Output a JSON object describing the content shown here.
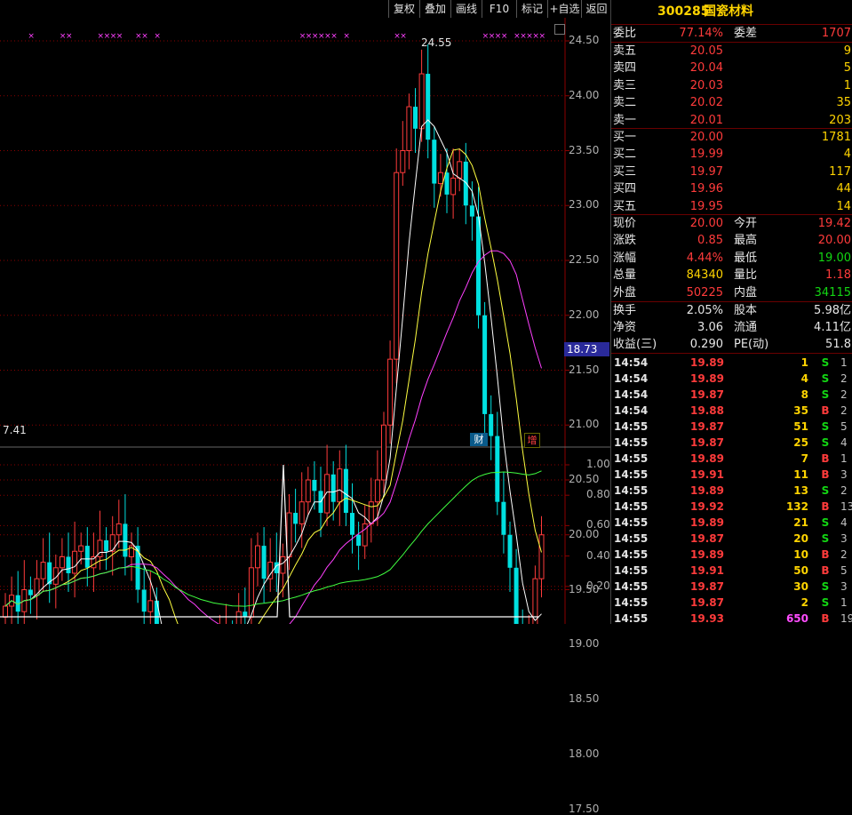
{
  "toolbar": {
    "buttons": [
      "复权",
      "叠加",
      "画线",
      "F10",
      "标记",
      "+自选",
      "返回"
    ]
  },
  "stock": {
    "code": "300285",
    "name": "国瓷材料"
  },
  "price_axis": {
    "labels": [
      "24.50",
      "24.00",
      "23.50",
      "23.00",
      "22.50",
      "22.00",
      "21.50",
      "21.00",
      "20.50",
      "20.00",
      "19.50",
      "19.00",
      "18.50",
      "18.00",
      "17.50"
    ],
    "current_tag": "18.73"
  },
  "volume_axis": {
    "labels": [
      "1.00",
      "0.80",
      "0.60",
      "0.40",
      "0.20"
    ]
  },
  "chart_annotations": {
    "high_label": "24.55",
    "low_label": "7.41",
    "marker_finance": "财",
    "marker_increase": "增"
  },
  "order_book": {
    "weibi": {
      "label": "委比",
      "value": "77.14%",
      "label2": "委差",
      "value2": "1707"
    },
    "asks": [
      {
        "label": "卖五",
        "price": "20.05",
        "vol": "9"
      },
      {
        "label": "卖四",
        "price": "20.04",
        "vol": "5"
      },
      {
        "label": "卖三",
        "price": "20.03",
        "vol": "1"
      },
      {
        "label": "卖二",
        "price": "20.02",
        "vol": "35"
      },
      {
        "label": "卖一",
        "price": "20.01",
        "vol": "203"
      }
    ],
    "bids": [
      {
        "label": "买一",
        "price": "20.00",
        "vol": "1781"
      },
      {
        "label": "买二",
        "price": "19.99",
        "vol": "4"
      },
      {
        "label": "买三",
        "price": "19.97",
        "vol": "117"
      },
      {
        "label": "买四",
        "price": "19.96",
        "vol": "44"
      },
      {
        "label": "买五",
        "price": "19.95",
        "vol": "14"
      }
    ]
  },
  "quote": [
    {
      "l1": "现价",
      "v1": "20.00",
      "c1": "red",
      "l2": "今开",
      "v2": "19.42",
      "c2": "red"
    },
    {
      "l1": "涨跌",
      "v1": "0.85",
      "c1": "red",
      "l2": "最高",
      "v2": "20.00",
      "c2": "red"
    },
    {
      "l1": "涨幅",
      "v1": "4.44%",
      "c1": "red",
      "l2": "最低",
      "v2": "19.00",
      "c2": "grn"
    },
    {
      "l1": "总量",
      "v1": "84340",
      "c1": "yel",
      "l2": "量比",
      "v2": "1.18",
      "c2": "red"
    },
    {
      "l1": "外盘",
      "v1": "50225",
      "c1": "red",
      "l2": "内盘",
      "v2": "34115",
      "c2": "grn"
    }
  ],
  "fundamentals": [
    {
      "l1": "换手",
      "v1": "2.05%",
      "l2": "股本",
      "v2": "5.98亿"
    },
    {
      "l1": "净资",
      "v1": "3.06",
      "l2": "流通",
      "v2": "4.11亿"
    },
    {
      "l1": "收益(三)",
      "v1": "0.290",
      "l2": "PE(动)",
      "v2": "51.8"
    }
  ],
  "trades": [
    {
      "t": "14:54",
      "p": "19.89",
      "v": "1",
      "bs": "S",
      "n": "1"
    },
    {
      "t": "14:54",
      "p": "19.89",
      "v": "4",
      "bs": "S",
      "n": "2"
    },
    {
      "t": "14:54",
      "p": "19.87",
      "v": "8",
      "bs": "S",
      "n": "2"
    },
    {
      "t": "14:54",
      "p": "19.88",
      "v": "35",
      "bs": "B",
      "n": "2"
    },
    {
      "t": "14:55",
      "p": "19.87",
      "v": "51",
      "bs": "S",
      "n": "5"
    },
    {
      "t": "14:55",
      "p": "19.87",
      "v": "25",
      "bs": "S",
      "n": "4"
    },
    {
      "t": "14:55",
      "p": "19.89",
      "v": "7",
      "bs": "B",
      "n": "1"
    },
    {
      "t": "14:55",
      "p": "19.91",
      "v": "11",
      "bs": "B",
      "n": "3"
    },
    {
      "t": "14:55",
      "p": "19.89",
      "v": "13",
      "bs": "S",
      "n": "2"
    },
    {
      "t": "14:55",
      "p": "19.92",
      "v": "132",
      "bs": "B",
      "n": "13"
    },
    {
      "t": "14:55",
      "p": "19.89",
      "v": "21",
      "bs": "S",
      "n": "4"
    },
    {
      "t": "14:55",
      "p": "19.87",
      "v": "20",
      "bs": "S",
      "n": "3"
    },
    {
      "t": "14:55",
      "p": "19.89",
      "v": "10",
      "bs": "B",
      "n": "2"
    },
    {
      "t": "14:55",
      "p": "19.91",
      "v": "50",
      "bs": "B",
      "n": "5"
    },
    {
      "t": "14:55",
      "p": "19.87",
      "v": "30",
      "bs": "S",
      "n": "3"
    },
    {
      "t": "14:55",
      "p": "19.87",
      "v": "2",
      "bs": "S",
      "n": "1"
    },
    {
      "t": "14:55",
      "p": "19.93",
      "v": "650",
      "bs": "B",
      "n": "19"
    }
  ],
  "colors": {
    "up": "#ff3b3b",
    "down": "#00e0e0",
    "ma5": "#ffffff",
    "ma10": "#ffff40",
    "ma20": "#ff40ff",
    "ma60": "#40ff40",
    "grid": "#8b0000"
  }
}
